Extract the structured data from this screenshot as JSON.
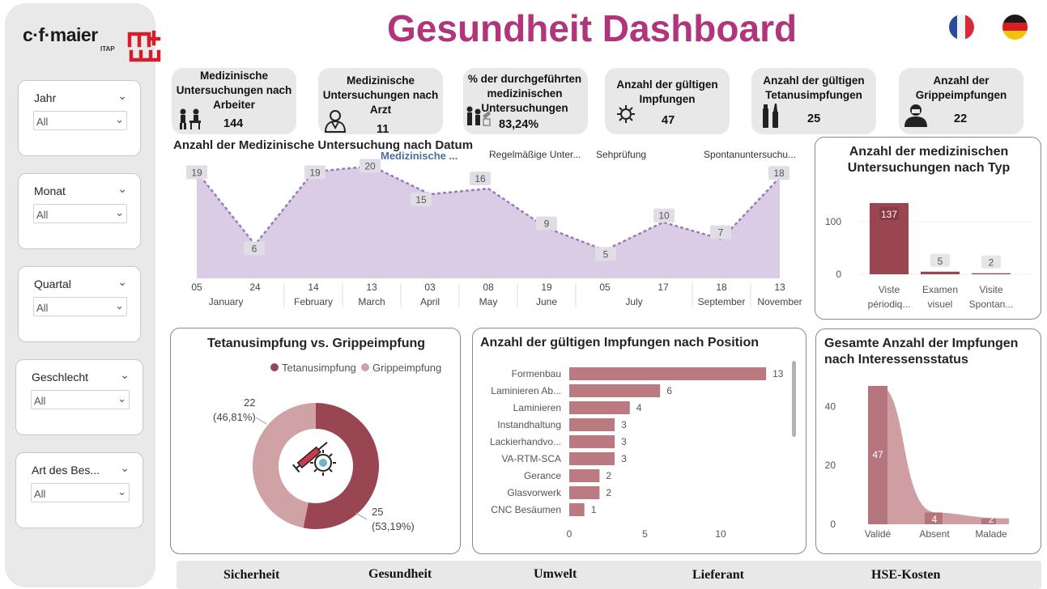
{
  "branding": {
    "logo_text": "c·f·maier",
    "logo_sub": "ITAP",
    "mark_icon": "cfmaier-mark-icon"
  },
  "header": {
    "title": "Gesundheit Dashboard",
    "flags": [
      "flag-france-icon",
      "flag-germany-icon"
    ]
  },
  "filters": [
    {
      "label": "Jahr",
      "value": "All"
    },
    {
      "label": "Monat",
      "value": "All"
    },
    {
      "label": "Quartal",
      "value": "All"
    },
    {
      "label": "Geschlecht",
      "value": "All"
    },
    {
      "label": "Art des Bes...",
      "value": "All"
    }
  ],
  "kpis": [
    {
      "title": "Medizinische Untersuchungen nach Arbeiter",
      "value": "144",
      "icon": "worker-exam-icon"
    },
    {
      "title": "Medizinische Untersuchungen nach Arzt",
      "value": "11",
      "icon": "doctor-icon"
    },
    {
      "title": "% der durchgeführten medizinischen Untersuchungen",
      "value": "83,24%",
      "icon": "people-check-icon"
    },
    {
      "title": "Anzahl der gültigen Impfungen",
      "value": "47",
      "icon": "virus-syringe-icon"
    },
    {
      "title": "Anzahl der gültigen Tetanusimpfungen",
      "value": "25",
      "icon": "vaccine-vials-icon"
    },
    {
      "title": "Anzahl der Grippeimpfungen",
      "value": "22",
      "icon": "flu-patient-icon"
    }
  ],
  "area_chart": {
    "title": "Anzahl der Medizinische Untersuchung nach Datum",
    "legend_title": "Medizinische ...",
    "legend_items": [
      "Regelmäßige Unter...",
      "Sehprüfung",
      "Spontanuntersuchu..."
    ],
    "fill_color": "#d9cce4",
    "line_color": "#9b7bb8"
  },
  "bar_type_chart": {
    "title_line1": "Anzahl der medizinischen",
    "title_line2": "Untersuchungen nach Typ",
    "bar_color": "#9a4652"
  },
  "donut_chart": {
    "title": "Tetanusimpfung vs. Grippeimpfung",
    "colors": {
      "Tetanusimpfung": "#9a4652",
      "Grippeimpfung": "#d0a2a6"
    },
    "label_tetanus_count": "25",
    "label_tetanus_pct": "(53,19%)",
    "label_grippe_count": "22",
    "label_grippe_pct": "(46,81%)"
  },
  "position_chart": {
    "title": "Anzahl der gültigen Impfungen nach Position",
    "bar_color": "#bb7a80"
  },
  "status_chart": {
    "title_line1": "Gesamte Anzahl der Impfungen",
    "title_line2": "nach Interessensstatus",
    "bar_color": "#b5757c",
    "area_color": "#cf9ea3"
  },
  "nav": [
    "Sicherheit",
    "Gesundheit",
    "Umwelt",
    "Lieferant",
    "HSE-Kosten"
  ],
  "chart_data": [
    {
      "type": "area",
      "title": "Anzahl der Medizinische Untersuchung nach Datum",
      "legend": [
        "Medizinische ...",
        "Regelmäßige Unter...",
        "Sehprüfung",
        "Spontanuntersuchu..."
      ],
      "x": [
        "05 January",
        "24 January",
        "14 February",
        "13 March",
        "03 April",
        "08 May",
        "19 June",
        "05 July",
        "17 July",
        "18 September",
        "13 November"
      ],
      "x_day": [
        "05",
        "24",
        "14",
        "13",
        "03",
        "08",
        "19",
        "05",
        "17",
        "18",
        "13"
      ],
      "x_month_labels": [
        "January",
        "February",
        "March",
        "April",
        "May",
        "June",
        "July",
        "September",
        "November"
      ],
      "values": [
        19,
        6,
        19,
        20,
        15,
        16,
        9,
        5,
        10,
        7,
        18
      ]
    },
    {
      "type": "bar",
      "title": "Anzahl der medizinischen Untersuchungen nach Typ",
      "categories": [
        [
          "Viste",
          "périodiq..."
        ],
        [
          "Examen",
          "visuel"
        ],
        [
          "Visite",
          "Spontan..."
        ]
      ],
      "values": [
        137,
        5,
        2
      ],
      "yticks": [
        0,
        100
      ]
    },
    {
      "type": "pie",
      "title": "Tetanusimpfung vs. Grippeimpfung",
      "labels": [
        "Tetanusimpfung",
        "Grippeimpfung"
      ],
      "values": [
        25,
        22
      ],
      "percent": [
        "53,19%",
        "46,81%"
      ]
    },
    {
      "type": "bar",
      "orientation": "horizontal",
      "title": "Anzahl der gültigen Impfungen nach Position",
      "categories": [
        "Formenbau",
        "Laminieren Ab...",
        "Laminieren",
        "Instandhaltung",
        "Lackierhandvo...",
        "VA-RTM-SCA",
        "Gerance",
        "Glasvorwerk",
        "CNC Besäumen"
      ],
      "values": [
        13,
        6,
        4,
        3,
        3,
        3,
        2,
        2,
        1
      ],
      "xticks": [
        0,
        5,
        10
      ]
    },
    {
      "type": "area",
      "title": "Gesamte Anzahl der Impfungen nach Interessensstatus",
      "categories": [
        "Validé",
        "Absent",
        "Malade"
      ],
      "values": [
        47,
        4,
        2
      ],
      "yticks": [
        0,
        20,
        40
      ]
    }
  ]
}
